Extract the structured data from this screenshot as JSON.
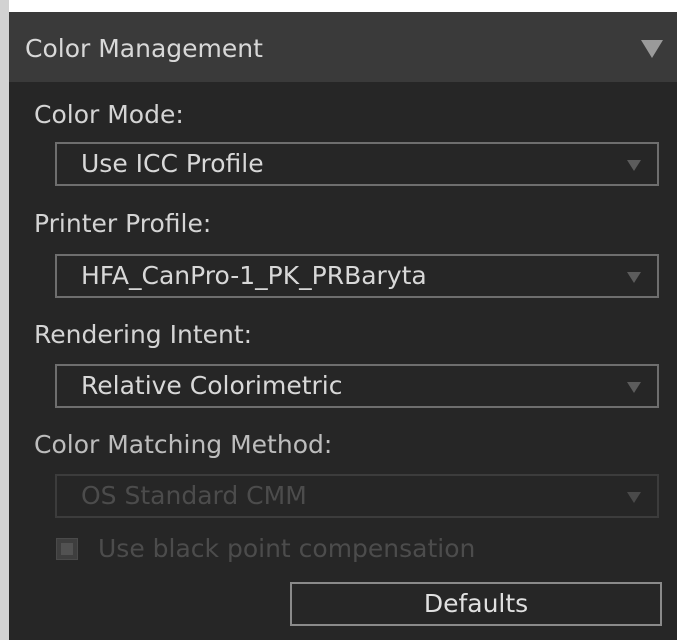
{
  "panel": {
    "title": "Color Management",
    "collapse_icon": "triangle-down-icon"
  },
  "color_mode": {
    "label": "Color Mode:",
    "value": "Use ICC Profile"
  },
  "printer_profile": {
    "label": "Printer Profile:",
    "value": "HFA_CanPro-1_PK_PRBaryta"
  },
  "rendering_intent": {
    "label": "Rendering Intent:",
    "value": "Relative Colorimetric"
  },
  "color_matching_method": {
    "label": "Color Matching Method:",
    "value": "OS Standard CMM",
    "enabled": false
  },
  "black_point": {
    "label": "Use black point compensation",
    "checked": true,
    "enabled": false
  },
  "defaults_button": {
    "label": "Defaults"
  },
  "colors": {
    "panel_bg": "#262626",
    "header_bg": "#3a3a3a",
    "text": "#d8d8d8",
    "disabled_text": "#4c4c4c"
  }
}
